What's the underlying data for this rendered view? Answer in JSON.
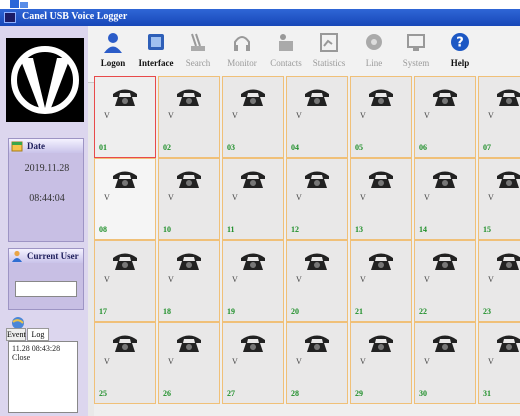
{
  "window": {
    "title": "Canel USB Voice Logger"
  },
  "toolbar": {
    "buttons": [
      {
        "label": "Logon",
        "icon": "user-icon",
        "enabled": true
      },
      {
        "label": "Interface",
        "icon": "interface-icon",
        "enabled": true
      },
      {
        "label": "Search",
        "icon": "search-icon",
        "enabled": false
      },
      {
        "label": "Monitor",
        "icon": "headphones-icon",
        "enabled": false
      },
      {
        "label": "Contacts",
        "icon": "contacts-icon",
        "enabled": false
      },
      {
        "label": "Statistics",
        "icon": "statistics-icon",
        "enabled": false
      },
      {
        "label": "Line",
        "icon": "line-icon",
        "enabled": false
      },
      {
        "label": "System",
        "icon": "system-icon",
        "enabled": false
      },
      {
        "label": "Help",
        "icon": "help-icon",
        "enabled": true
      }
    ]
  },
  "sidebar": {
    "date_panel": {
      "label": "Date",
      "date": "2019.11.28",
      "time": "08:44:04"
    },
    "user_panel": {
      "label": "Current User",
      "value": ""
    },
    "log_panel": {
      "tabs": [
        "Event",
        "Log"
      ],
      "active_tab": "Log",
      "entries": [
        "11.28 08:43:28",
        "Close"
      ]
    }
  },
  "channels": [
    {
      "num": "01",
      "state": "V",
      "selected": true
    },
    {
      "num": "02",
      "state": "V"
    },
    {
      "num": "03",
      "state": "V"
    },
    {
      "num": "04",
      "state": "V"
    },
    {
      "num": "05",
      "state": "V"
    },
    {
      "num": "06",
      "state": "V"
    },
    {
      "num": "07",
      "state": "V"
    },
    {
      "num": "08",
      "state": "V",
      "light": true
    },
    {
      "num": "10",
      "state": "V"
    },
    {
      "num": "11",
      "state": "V"
    },
    {
      "num": "12",
      "state": "V"
    },
    {
      "num": "13",
      "state": "V"
    },
    {
      "num": "14",
      "state": "V"
    },
    {
      "num": "15",
      "state": "V"
    },
    {
      "num": "17",
      "state": "V"
    },
    {
      "num": "18",
      "state": "V"
    },
    {
      "num": "19",
      "state": "V"
    },
    {
      "num": "20",
      "state": "V"
    },
    {
      "num": "21",
      "state": "V"
    },
    {
      "num": "22",
      "state": "V"
    },
    {
      "num": "23",
      "state": "V"
    },
    {
      "num": "25",
      "state": "V"
    },
    {
      "num": "26",
      "state": "V"
    },
    {
      "num": "27",
      "state": "V"
    },
    {
      "num": "28",
      "state": "V"
    },
    {
      "num": "29",
      "state": "V"
    },
    {
      "num": "30",
      "state": "V"
    },
    {
      "num": "31",
      "state": "V"
    }
  ]
}
